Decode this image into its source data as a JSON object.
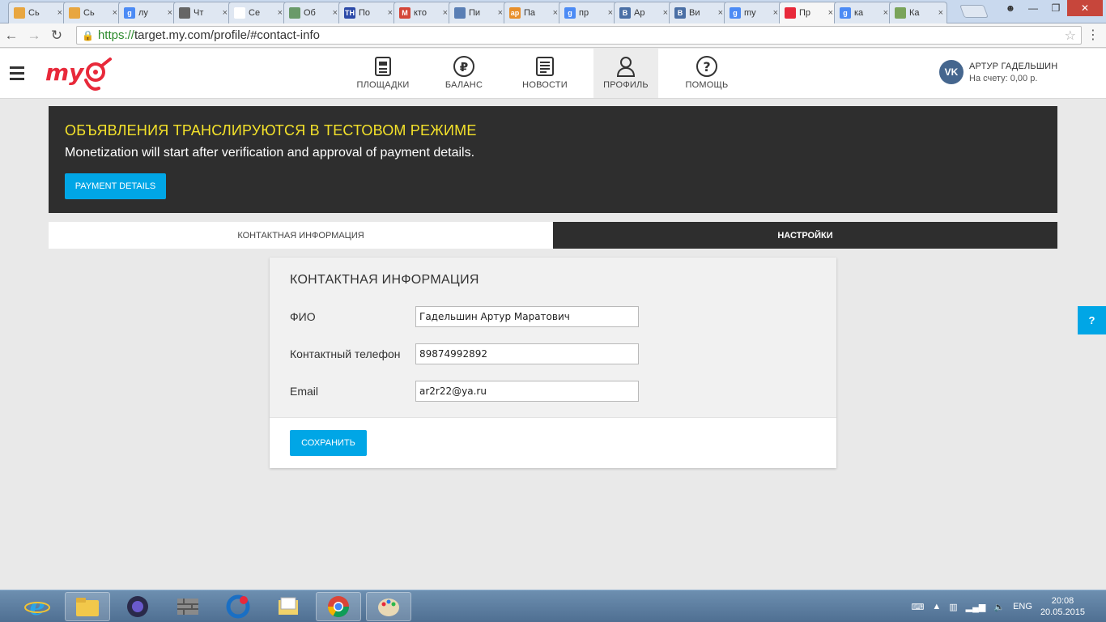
{
  "browser": {
    "tabs": [
      {
        "title": "Сь",
        "color": "#e8a640",
        "glyph": ""
      },
      {
        "title": "Сь",
        "color": "#e8a640",
        "glyph": ""
      },
      {
        "title": "лу",
        "color": "#4c8bf5",
        "glyph": "g"
      },
      {
        "title": "Чт",
        "color": "#666666",
        "glyph": ""
      },
      {
        "title": "Се",
        "color": "#ffffff",
        "glyph": ""
      },
      {
        "title": "Об",
        "color": "#6a9a6a",
        "glyph": ""
      },
      {
        "title": "По",
        "color": "#2c4aa8",
        "glyph": "ТН"
      },
      {
        "title": "кто",
        "color": "#d44638",
        "glyph": "M"
      },
      {
        "title": "Пи",
        "color": "#5a7fb5",
        "glyph": ""
      },
      {
        "title": "Па",
        "color": "#e88f2a",
        "glyph": "ар"
      },
      {
        "title": "пр",
        "color": "#4c8bf5",
        "glyph": "g"
      },
      {
        "title": "Ар",
        "color": "#4a6fa5",
        "glyph": "B"
      },
      {
        "title": "Ви",
        "color": "#4a6fa5",
        "glyph": "B"
      },
      {
        "title": "my",
        "color": "#4c8bf5",
        "glyph": "g"
      },
      {
        "title": "Пр",
        "color": "#e8293a",
        "glyph": "",
        "active": true
      },
      {
        "title": "ка",
        "color": "#4c8bf5",
        "glyph": "g"
      },
      {
        "title": "Ка",
        "color": "#7aa45a",
        "glyph": ""
      }
    ],
    "url_scheme": "https://",
    "url_rest": "target.my.com/profile/#contact-info"
  },
  "header": {
    "nav": [
      {
        "label": "ПЛОЩАДКИ",
        "icon": "sites-icon"
      },
      {
        "label": "БАЛАНС",
        "icon": "ruble-icon"
      },
      {
        "label": "НОВОСТИ",
        "icon": "news-icon"
      },
      {
        "label": "ПРОФИЛЬ",
        "icon": "profile-icon",
        "active": true
      },
      {
        "label": "ПОМОЩЬ",
        "icon": "help-icon"
      }
    ],
    "user_name": "АРТУР ГАДЕЛЬШИН",
    "balance": "На счету: 0,00 р.",
    "vk_label": "VK"
  },
  "banner": {
    "heading": "ОБЪЯВЛЕНИЯ ТРАНСЛИРУЮТСЯ В ТЕСТОВОМ РЕЖИМЕ",
    "subtitle": "Monetization will start after verification and approval of payment details.",
    "button_label": "PAYMENT DETAILS"
  },
  "profile_tabs": {
    "contact": "КОНТАКТНАЯ ИНФОРМАЦИЯ",
    "settings": "НАСТРОЙКИ"
  },
  "form": {
    "title": "КОНТАКТНАЯ ИНФОРМАЦИЯ",
    "fields": [
      {
        "label": "ФИО",
        "value": "Гадельшин Артур Маратович"
      },
      {
        "label": "Контактный телефон",
        "value": "89874992892"
      },
      {
        "label": "Email",
        "value": "ar2r22@ya.ru"
      }
    ],
    "save_label": "СОХРАНИТЬ"
  },
  "help_button": "?",
  "taskbar": {
    "lang": "ENG",
    "time": "20:08",
    "date": "20.05.2015"
  }
}
